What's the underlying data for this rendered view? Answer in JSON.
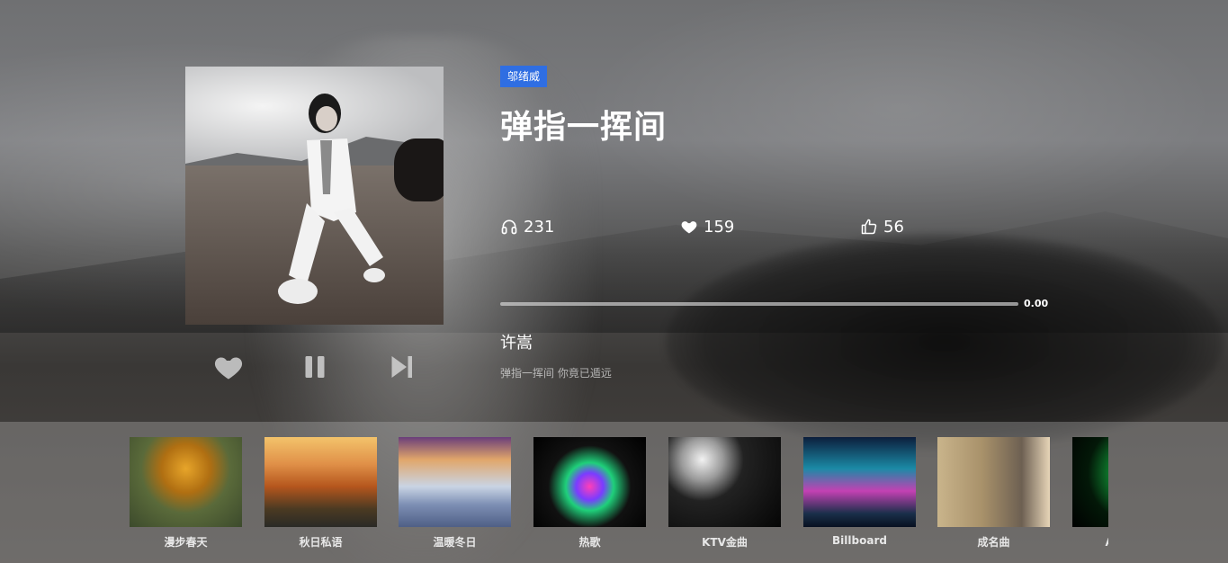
{
  "song": {
    "artist_tag": "邬绪威",
    "title": "弹指一挥间",
    "singer": "许嵩",
    "lyric": "弹指一挥间 你竟已遁远",
    "progress": 0.0,
    "time": "0.00"
  },
  "stats": {
    "listens": "231",
    "favorites": "159",
    "likes": "56"
  },
  "controls": {
    "favorite_icon": "heart-icon",
    "pause_icon": "pause-icon",
    "next_icon": "skip-next-icon"
  },
  "playlists": [
    {
      "name": "漫步春天"
    },
    {
      "name": "秋日私语"
    },
    {
      "name": "温暖冬日"
    },
    {
      "name": "热歌"
    },
    {
      "name": "KTV金曲"
    },
    {
      "name": "Billboard"
    },
    {
      "name": "成名曲"
    },
    {
      "name": "ACG新歌"
    }
  ]
}
